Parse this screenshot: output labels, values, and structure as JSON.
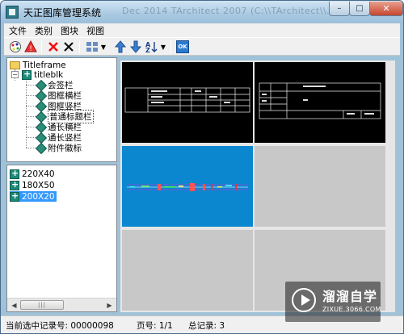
{
  "window": {
    "title": "天正图库管理系统",
    "blurred_background_text": "Dec 2014 TArchitect 2007 (C:\\\\TArchitect\\\\...)",
    "minimize_symbol": "–",
    "maximize_symbol": "□",
    "close_symbol": "✕"
  },
  "menu": [
    "文件",
    "类别",
    "图块",
    "视图"
  ],
  "toolbar": {
    "icons": [
      "palette-icon",
      "warning-icon",
      "delete-red-x-icon",
      "delete-black-x-icon",
      "view-mode-icon",
      "move-up-icon",
      "move-down-icon",
      "sort-az-icon",
      "ok-icon"
    ],
    "ok_label": "OK"
  },
  "tree": {
    "root": "Titleframe",
    "child": "titleblk",
    "leaves": [
      "会签栏",
      "图框横栏",
      "图框竖栏",
      "普通标题栏",
      "通长横栏",
      "通长竖栏",
      "附件徽标"
    ],
    "selected_leaf_index": 3
  },
  "list": {
    "items": [
      "220X40",
      "180X50",
      "200X20"
    ],
    "selected_index": 2
  },
  "preview": {
    "cells": [
      "black",
      "black",
      "blue",
      "gray",
      "gray",
      "gray"
    ],
    "colors": {
      "black": "#000000",
      "blue": "#0b87d0",
      "gray": "#c8c8c8"
    }
  },
  "status": {
    "record_label": "当前选中记录号: 00000098",
    "page_label": "页号: 1/1",
    "total_label": "总记录:  3"
  },
  "watermark": {
    "name": "溜溜自学",
    "url": "ZIXUE.3066.COM"
  }
}
